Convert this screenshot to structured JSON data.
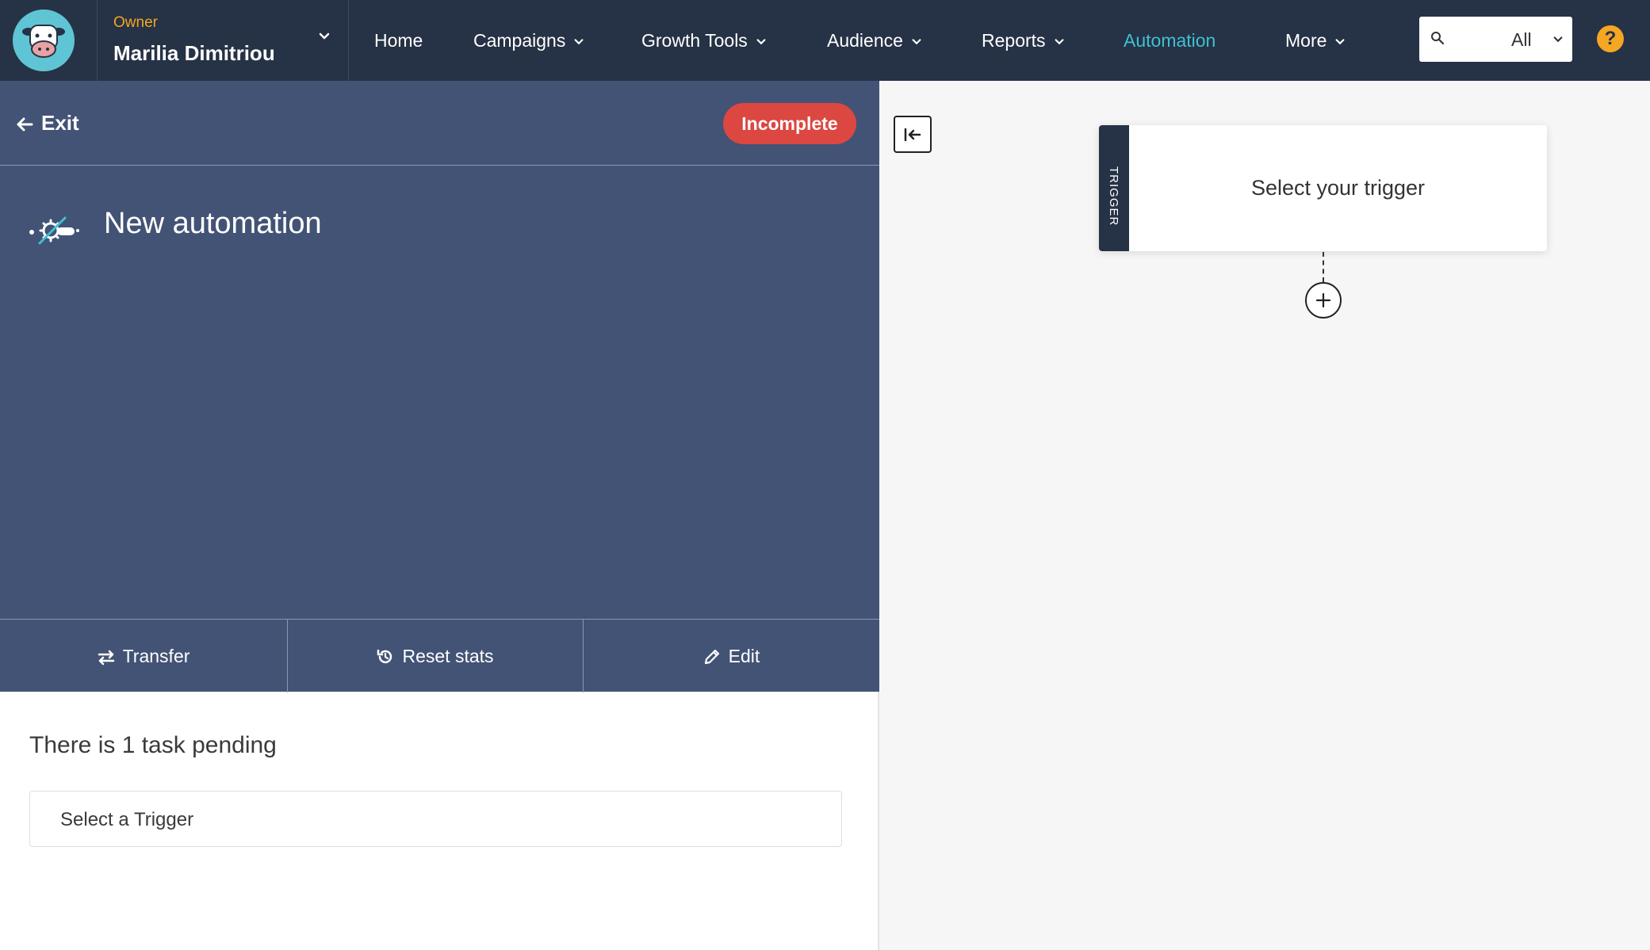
{
  "account": {
    "role": "Owner",
    "name": "Marilia Dimitriou"
  },
  "nav": {
    "items": [
      {
        "label": "Home"
      },
      {
        "label": "Campaigns"
      },
      {
        "label": "Growth Tools"
      },
      {
        "label": "Audience"
      },
      {
        "label": "Reports"
      },
      {
        "label": "Automation",
        "active": true
      },
      {
        "label": "More"
      }
    ]
  },
  "search": {
    "scope": "All"
  },
  "help": {
    "symbol": "?"
  },
  "editor": {
    "exit_label": "Exit",
    "status": "Incomplete",
    "title": "New automation",
    "actions": {
      "transfer": "Transfer",
      "reset": "Reset stats",
      "edit": "Edit"
    },
    "pending_text": "There is 1 task pending",
    "tasks": [
      "Select a Trigger"
    ]
  },
  "canvas": {
    "trigger_tab": "TRIGGER",
    "trigger_text": "Select your trigger"
  },
  "colors": {
    "nav_bg": "#263245",
    "panel_bg": "#435375",
    "accent_active": "#3ec1d3",
    "status_incomplete": "#dc4741",
    "owner_label": "#f5a623"
  }
}
